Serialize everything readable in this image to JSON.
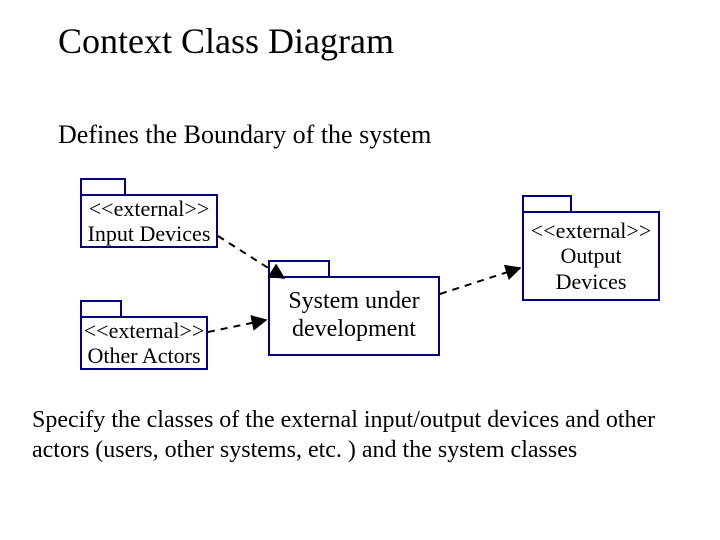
{
  "title": "Context Class Diagram",
  "subtitle": "Defines the Boundary of the system",
  "body_text": "Specify the classes of the external input/output devices and other actors (users, other systems, etc. ) and the system classes",
  "packages": {
    "input_devices": {
      "stereotype": "<<external>>",
      "label": "Input Devices"
    },
    "other_actors": {
      "stereotype": "<<external>>",
      "label": "Other Actors"
    },
    "system": {
      "label": "System under development"
    },
    "output_devices": {
      "stereotype": "<<external>>",
      "label": "Output Devices"
    }
  }
}
